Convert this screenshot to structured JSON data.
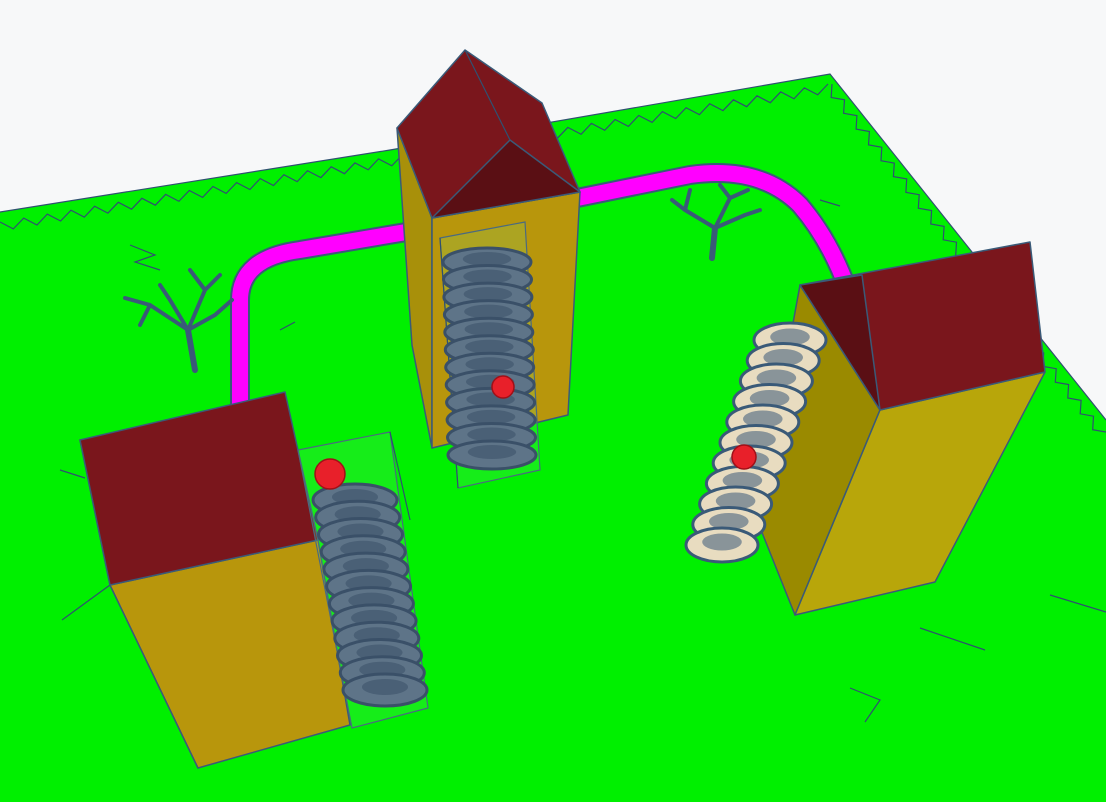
{
  "scene": {
    "ground_color": "#00f000",
    "roof_color": "#7a161c",
    "roof_shadow_color": "#5a0f14",
    "wall_color": "#b8960c",
    "wall_shadow_color": "#9a8a00",
    "path_color": "#ff00ff",
    "edge_color": "#3a5a78",
    "slide_metal_color": "#5e7488",
    "slide_cream_color": "#e8dcc0",
    "ball_color": "#e8202a",
    "tree_color": "#3a5a78"
  },
  "objects": [
    {
      "name": "ground-plane",
      "icon": "ground-icon"
    },
    {
      "name": "path-tube",
      "icon": "tube-icon"
    },
    {
      "name": "tower-back",
      "icon": "house-icon"
    },
    {
      "name": "tower-left",
      "icon": "house-icon"
    },
    {
      "name": "tower-right",
      "icon": "house-icon"
    },
    {
      "name": "spiral-slide-back",
      "icon": "spiral-icon"
    },
    {
      "name": "spiral-slide-left",
      "icon": "spiral-icon"
    },
    {
      "name": "spiral-slide-right",
      "icon": "spiral-icon"
    },
    {
      "name": "tree-left",
      "icon": "tree-icon"
    },
    {
      "name": "tree-back",
      "icon": "tree-icon"
    }
  ]
}
